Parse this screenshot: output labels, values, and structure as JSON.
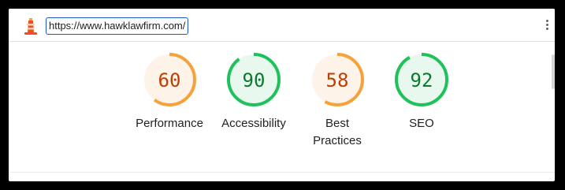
{
  "browser": {
    "url": "https://www.hawklawfirm.com/"
  },
  "colors": {
    "average": "#f5a23a",
    "average_fill": "#fdf3e8",
    "average_text": "#c23d00",
    "pass": "#1fc15b",
    "pass_fill": "#e8f8ee",
    "pass_text": "#0b7a2e"
  },
  "gauges": [
    {
      "label": "Performance",
      "score": "60",
      "status": "average"
    },
    {
      "label": "Accessibility",
      "score": "90",
      "status": "pass"
    },
    {
      "label": "Best\nPractices",
      "score": "58",
      "status": "average"
    },
    {
      "label": "SEO",
      "score": "92",
      "status": "pass"
    }
  ],
  "icons": {
    "logo": "lighthouse-icon",
    "menu": "more-vert-icon"
  }
}
